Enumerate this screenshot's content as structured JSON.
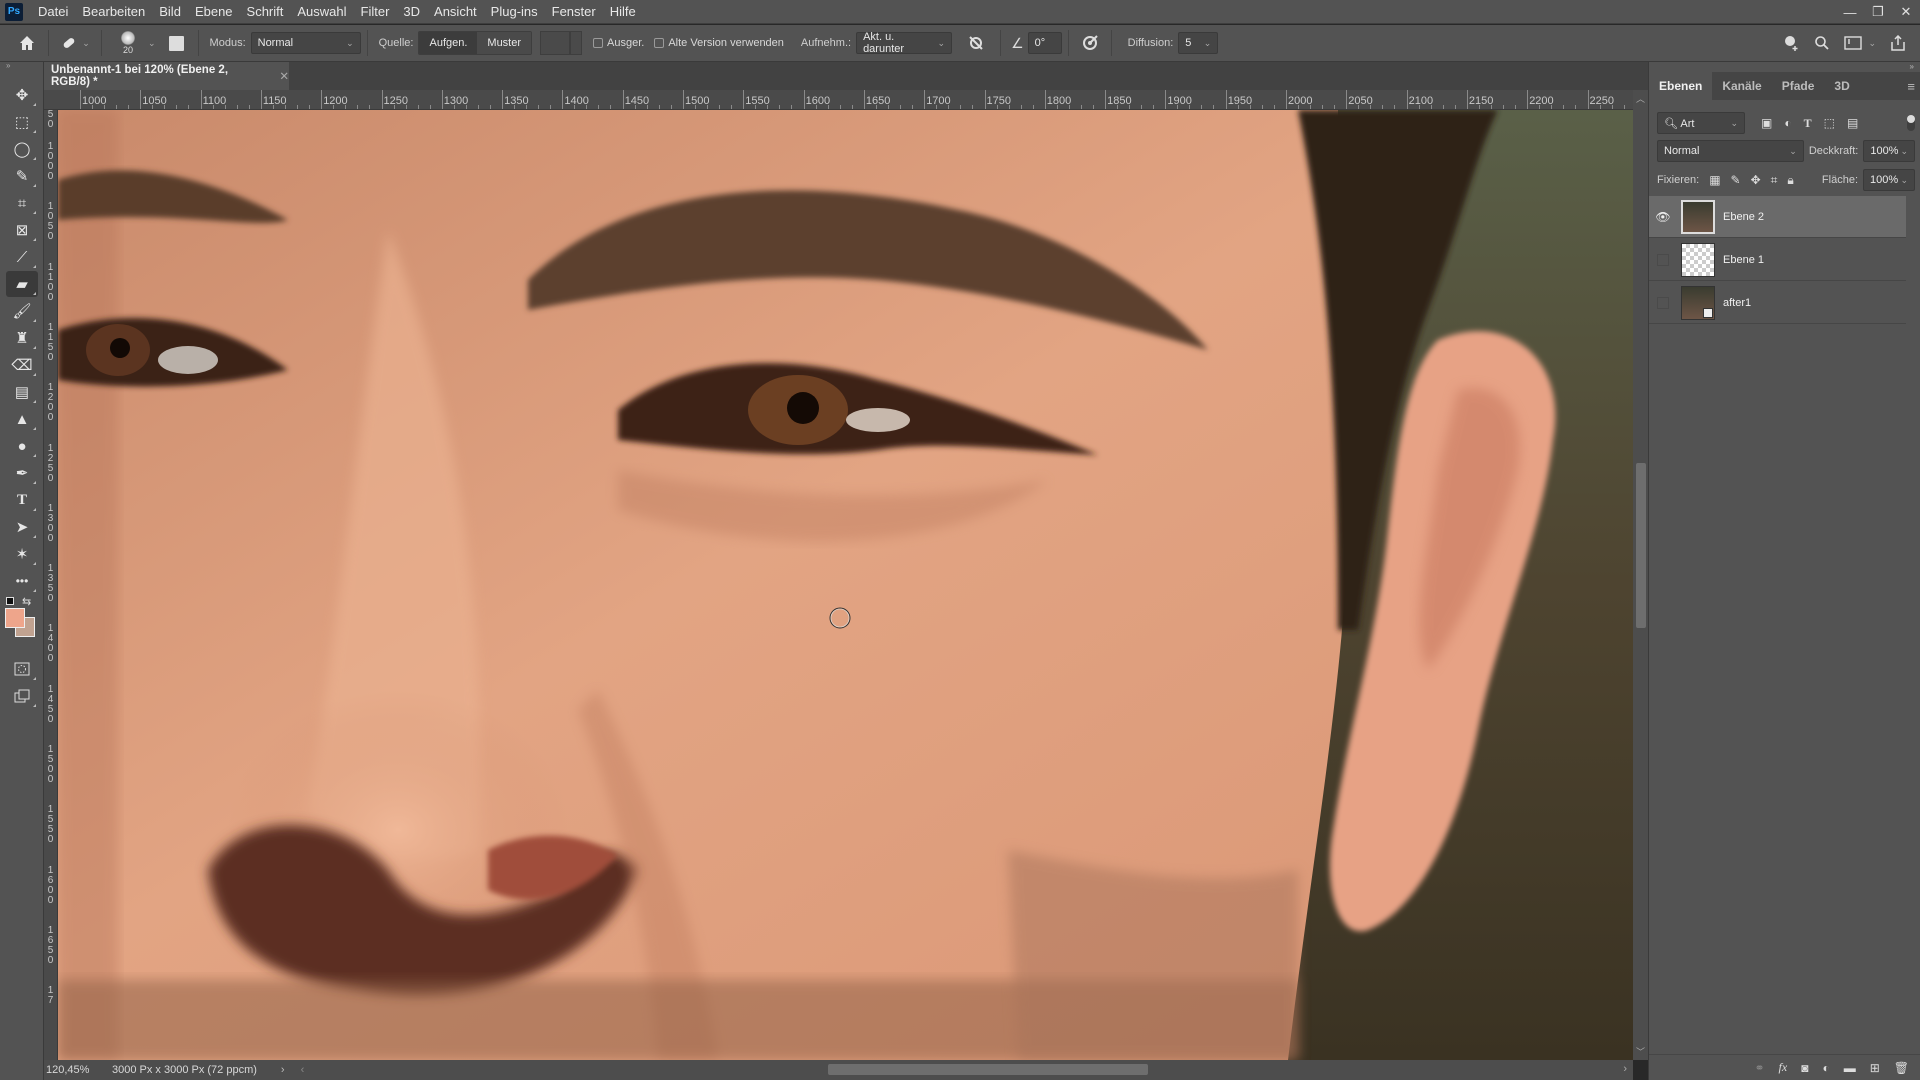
{
  "app": {
    "logo": "Ps"
  },
  "menu": [
    "Datei",
    "Bearbeiten",
    "Bild",
    "Ebene",
    "Schrift",
    "Auswahl",
    "Filter",
    "3D",
    "Ansicht",
    "Plug-ins",
    "Fenster",
    "Hilfe"
  ],
  "window_controls": {
    "minimize": "—",
    "restore": "❐",
    "close": "✕"
  },
  "options": {
    "brush_size": "20",
    "mode_label": "Modus:",
    "mode_value": "Normal",
    "source_label": "Quelle:",
    "source_options": [
      "Aufgen.",
      "Muster"
    ],
    "source_selected": "Aufgen.",
    "aligned_label": "Ausger.",
    "legacy_label": "Alte Version verwenden",
    "sample_label": "Aufnehm.:",
    "sample_value": "Akt. u. darunter",
    "angle_value": "0°",
    "diffusion_label": "Diffusion:",
    "diffusion_value": "5"
  },
  "document": {
    "tab_title": "Unbenannt-1 bei 120% (Ebene 2, RGB/8) *",
    "zoom": "120,45%",
    "size_info": "3000 Px x 3000 Px (72 ppcm)"
  },
  "ruler": {
    "h_labels": [
      "1000",
      "1050",
      "1100",
      "1150",
      "1200",
      "1250",
      "1300",
      "1350",
      "1400",
      "1450",
      "1500",
      "1550",
      "1600",
      "1650",
      "1700",
      "1750",
      "1800",
      "1850",
      "1900",
      "1950",
      "2000",
      "2050",
      "2100",
      "2150",
      "2200",
      "2250"
    ],
    "v_labels": [
      "50",
      "1000",
      "1050",
      "1100",
      "1150",
      "1200",
      "1250",
      "1300",
      "1350",
      "1400",
      "1450",
      "1500",
      "1550",
      "1600",
      "1650",
      "17"
    ]
  },
  "tools": [
    "move",
    "marquee",
    "lasso",
    "quick-selection",
    "crop",
    "frame",
    "eyedropper",
    "healing-brush",
    "brush",
    "clone-stamp",
    "eraser",
    "gradient",
    "blur",
    "dodge",
    "pen",
    "type",
    "path-selection",
    "custom-shape",
    "more"
  ],
  "colors": {
    "foreground": "#eea58b",
    "background": "#c0a290",
    "accent": "#31a8ff"
  },
  "layers_panel": {
    "tabs": [
      "Ebenen",
      "Kanäle",
      "Pfade",
      "3D"
    ],
    "active_tab": "Ebenen",
    "filter_label": "Art",
    "blend_mode": "Normal",
    "opacity_label": "Deckkraft:",
    "opacity_value": "100%",
    "lock_label": "Fixieren:",
    "fill_label": "Fläche:",
    "fill_value": "100%",
    "layers": [
      {
        "name": "Ebene 2",
        "visible": true,
        "selected": true,
        "thumb": "photo"
      },
      {
        "name": "Ebene 1",
        "visible": false,
        "selected": false,
        "thumb": "transparent"
      },
      {
        "name": "after1",
        "visible": false,
        "selected": false,
        "thumb": "smart-object"
      }
    ]
  }
}
